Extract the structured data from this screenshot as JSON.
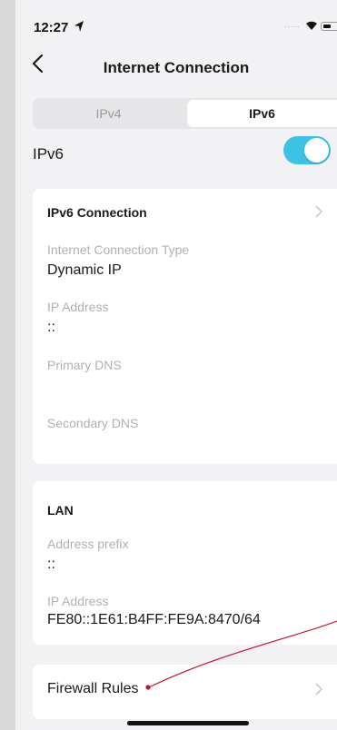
{
  "status_bar": {
    "time": "12:27",
    "signal_dots": "....."
  },
  "nav": {
    "title": "Internet Connection"
  },
  "tabs": [
    {
      "label": "IPv4"
    },
    {
      "label": "IPv6"
    }
  ],
  "ipv6_toggle": {
    "label": "IPv6",
    "state": "on"
  },
  "ipv6_connection": {
    "header": "IPv6 Connection",
    "fields": [
      {
        "label": "Internet Connection Type",
        "value": "Dynamic IP"
      },
      {
        "label": "IP Address",
        "value": "::"
      },
      {
        "label": "Primary DNS",
        "value": ""
      },
      {
        "label": "Secondary DNS",
        "value": ""
      }
    ]
  },
  "lan": {
    "header": "LAN",
    "fields": [
      {
        "label": "Address prefix",
        "value": "::"
      },
      {
        "label": "IP Address",
        "value": "FE80::1E61:B4FF:FE9A:8470/64"
      }
    ]
  },
  "firewall": {
    "label": "Firewall Rules"
  },
  "colors": {
    "accent": "#3cc3e3",
    "annotation": "#c8102e",
    "background": "#f2f2f4"
  }
}
